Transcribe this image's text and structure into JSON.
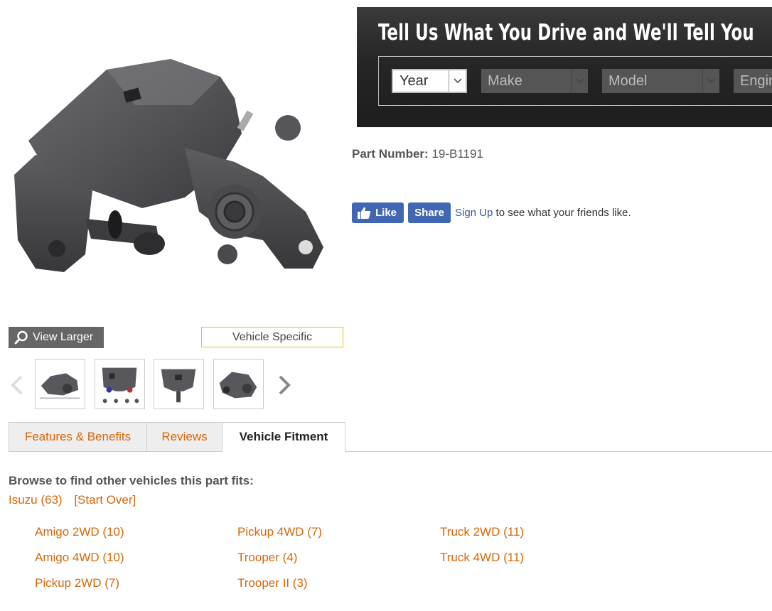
{
  "product": {
    "view_larger_label": "View Larger",
    "vehicle_specific_label": "Vehicle Specific"
  },
  "selector": {
    "headline": "Tell Us What You Drive and We'll Tell You",
    "year": "Year",
    "make": "Make",
    "model": "Model",
    "engine": "Engine"
  },
  "part": {
    "label": "Part Number:",
    "value": "19-B1191"
  },
  "social": {
    "like_label": "Like",
    "share_label": "Share",
    "signup_link": "Sign Up",
    "signup_text": " to see what your friends like."
  },
  "tabs": [
    {
      "label": "Features & Benefits",
      "active": false
    },
    {
      "label": "Reviews",
      "active": false
    },
    {
      "label": "Vehicle Fitment",
      "active": true
    }
  ],
  "fitment": {
    "browse_title": "Browse to find other vehicles this part fits:",
    "make_crumb": "Isuzu (63)",
    "start_over": "[Start Over]",
    "models": [
      "Amigo 2WD (10)",
      "Amigo 4WD (10)",
      "Pickup 2WD (7)",
      "Pickup 4WD (7)",
      "Trooper (4)",
      "Trooper II (3)",
      "Truck 2WD (11)",
      "Truck 4WD (11)"
    ]
  },
  "colors": {
    "accent_orange": "#d4680a",
    "facebook_blue": "#4267b2",
    "banner_dark": "#262626",
    "vehicle_specific_border": "#e8c400"
  }
}
